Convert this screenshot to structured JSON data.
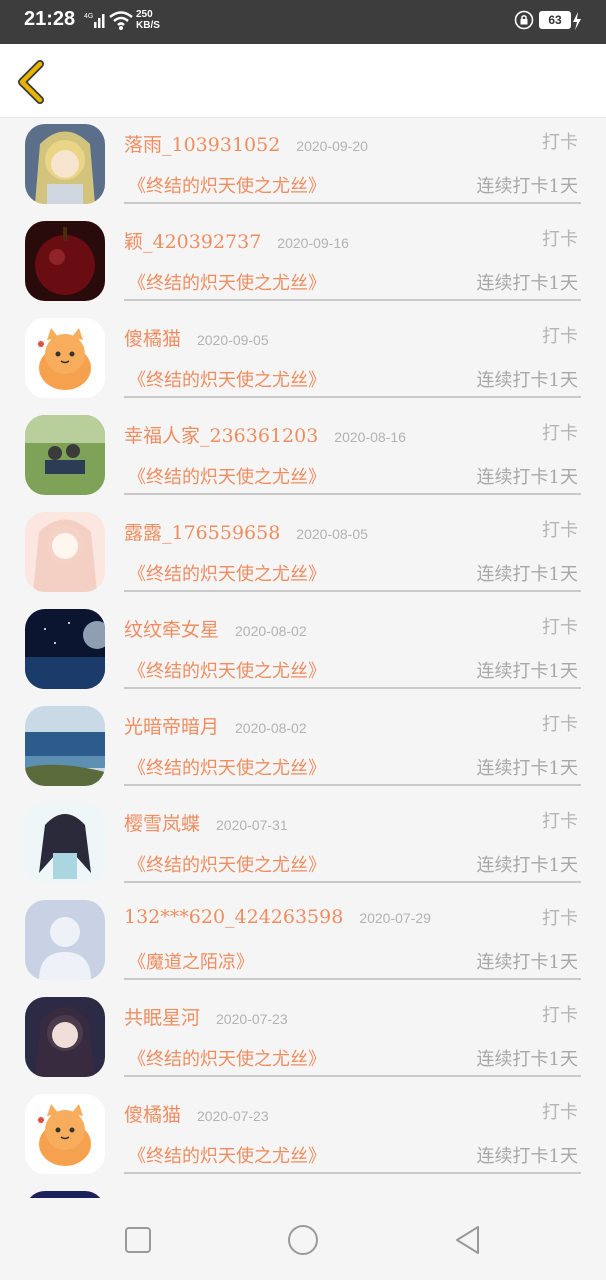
{
  "status_bar": {
    "time": "21:28",
    "network": "4G",
    "speed_value": "250",
    "speed_unit": "KB/S",
    "battery": "63",
    "signal_icon": "signal-bars-icon",
    "wifi_icon": "wifi-icon",
    "lock_icon": "rotation-lock-icon",
    "charging_icon": "bolt-icon"
  },
  "nav": {
    "back_icon": "chevron-left-icon",
    "accent_color": "#e8b400"
  },
  "colors": {
    "name": "#ef8d5f",
    "book": "#ef8d5f",
    "muted": "#b5b5b5",
    "background": "#f6f5f6"
  },
  "entries": [
    {
      "name": "落雨_103931052",
      "date": "2020-09-20",
      "action": "打卡",
      "book": "《终结的炽天使之尤丝》",
      "streak": "连续打卡1天"
    },
    {
      "name": "颖_420392737",
      "date": "2020-09-16",
      "action": "打卡",
      "book": "《终结的炽天使之尤丝》",
      "streak": "连续打卡1天"
    },
    {
      "name": "傻橘猫",
      "date": "2020-09-05",
      "action": "打卡",
      "book": "《终结的炽天使之尤丝》",
      "streak": "连续打卡1天"
    },
    {
      "name": "幸福人家_236361203",
      "date": "2020-08-16",
      "action": "打卡",
      "book": "《终结的炽天使之尤丝》",
      "streak": "连续打卡1天"
    },
    {
      "name": "露露_176559658",
      "date": "2020-08-05",
      "action": "打卡",
      "book": "《终结的炽天使之尤丝》",
      "streak": "连续打卡1天"
    },
    {
      "name": "纹纹牵女星",
      "date": "2020-08-02",
      "action": "打卡",
      "book": "《终结的炽天使之尤丝》",
      "streak": "连续打卡1天"
    },
    {
      "name": "光暗帝暗月",
      "date": "2020-08-02",
      "action": "打卡",
      "book": "《终结的炽天使之尤丝》",
      "streak": "连续打卡1天"
    },
    {
      "name": "樱雪岚蝶",
      "date": "2020-07-31",
      "action": "打卡",
      "book": "《终结的炽天使之尤丝》",
      "streak": "连续打卡1天"
    },
    {
      "name": "132***620_424263598",
      "date": "2020-07-29",
      "action": "打卡",
      "book": "《魔道之陌凉》",
      "streak": "连续打卡1天"
    },
    {
      "name": "共眠星河",
      "date": "2020-07-23",
      "action": "打卡",
      "book": "《终结的炽天使之尤丝》",
      "streak": "连续打卡1天"
    },
    {
      "name": "傻橘猫",
      "date": "2020-07-23",
      "action": "打卡",
      "book": "《终结的炽天使之尤丝》",
      "streak": "连续打卡1天"
    }
  ],
  "system_nav": {
    "recent_icon": "square-icon",
    "home_icon": "circle-icon",
    "back_icon": "triangle-back-icon"
  }
}
